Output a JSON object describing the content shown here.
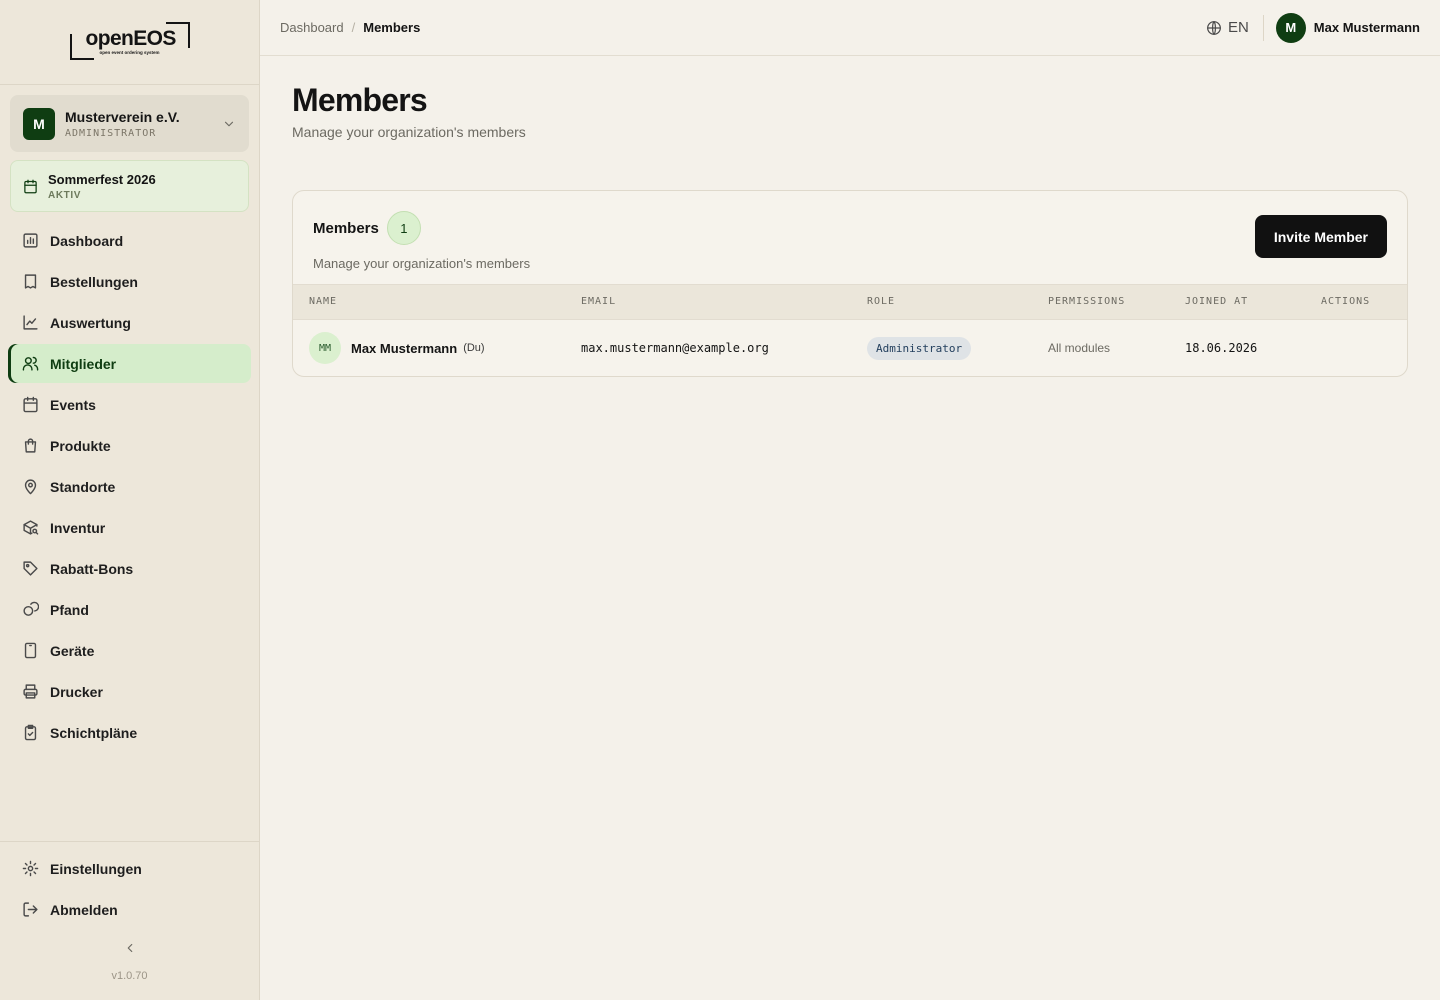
{
  "brand": {
    "logo_word": "openEOS",
    "logo_tag": "open event ordering system"
  },
  "org": {
    "avatar": "M",
    "name": "Musterverein e.V.",
    "role": "ADMINISTRATOR"
  },
  "event": {
    "name": "Sommerfest 2026",
    "status": "AKTIV"
  },
  "nav": [
    {
      "label": "Dashboard",
      "icon": "chart-bar-icon"
    },
    {
      "label": "Bestellungen",
      "icon": "receipt-icon"
    },
    {
      "label": "Auswertung",
      "icon": "line-chart-icon"
    },
    {
      "label": "Mitglieder",
      "icon": "users-icon",
      "active": true
    },
    {
      "label": "Events",
      "icon": "calendar-icon"
    },
    {
      "label": "Produkte",
      "icon": "shopping-bag-icon"
    },
    {
      "label": "Standorte",
      "icon": "map-pin-icon"
    },
    {
      "label": "Inventur",
      "icon": "package-search-icon"
    },
    {
      "label": "Rabatt-Bons",
      "icon": "tag-icon"
    },
    {
      "label": "Pfand",
      "icon": "coins-icon"
    },
    {
      "label": "Geräte",
      "icon": "tablet-icon"
    },
    {
      "label": "Drucker",
      "icon": "printer-icon"
    },
    {
      "label": "Schichtpläne",
      "icon": "clipboard-check-icon"
    }
  ],
  "nav_bottom": [
    {
      "label": "Einstellungen",
      "icon": "gear-icon"
    },
    {
      "label": "Abmelden",
      "icon": "logout-icon"
    }
  ],
  "version": "v1.0.70",
  "breadcrumb": {
    "parent": "Dashboard",
    "separator": "/",
    "current": "Members"
  },
  "header": {
    "language": "EN",
    "user_avatar": "M",
    "user_name": "Max Mustermann"
  },
  "page": {
    "title": "Members",
    "subtitle": "Manage your organization's members"
  },
  "card": {
    "title": "Members",
    "count": "1",
    "subtitle": "Manage your organization's members",
    "invite_label": "Invite Member"
  },
  "table": {
    "columns": [
      "NAME",
      "EMAIL",
      "ROLE",
      "PERMISSIONS",
      "JOINED AT",
      "ACTIONS"
    ],
    "rows": [
      {
        "initials": "MM",
        "name": "Max Mustermann",
        "you": "(Du)",
        "email": "max.mustermann@example.org",
        "role": "Administrator",
        "permissions": "All modules",
        "joined": "18.06.2026"
      }
    ]
  },
  "colors": {
    "accent": "#0f3d12",
    "active_bg": "#d5edcb",
    "sidebar_bg": "#ede7da",
    "page_bg": "#f4f1ea",
    "button_bg": "#111111"
  }
}
